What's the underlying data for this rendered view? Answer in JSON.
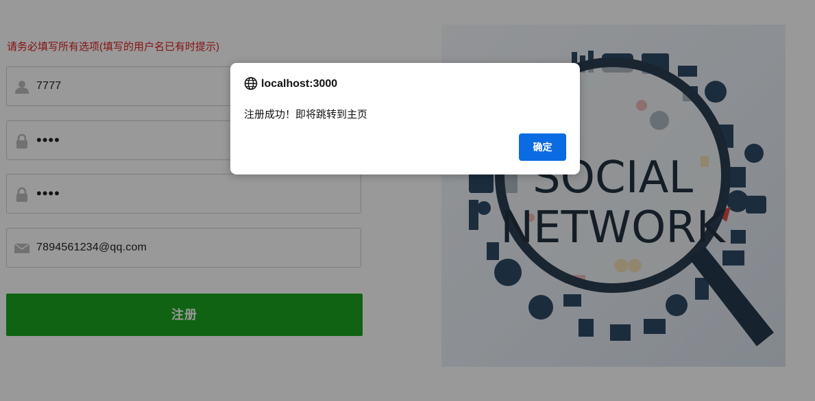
{
  "form": {
    "notice": "请务必填写所有选项(填写的用户名已有时提示)",
    "username_value": "7777",
    "password_value": "••••",
    "confirm_password_value": "••••",
    "email_value": "7894561234@qq.com",
    "register_label": "注册"
  },
  "hero": {
    "text_line1": "SOCIAL",
    "text_line2": "NETWORK",
    "icon": "magnifying-glass-social-network-illustration"
  },
  "dialog": {
    "origin": "localhost:3000",
    "message": "注册成功！即将跳转到主页",
    "ok_label": "确定"
  },
  "colors": {
    "notice": "#e02020",
    "register_button": "#1aa51f",
    "dialog_button": "#0b6be3",
    "overlay": "rgba(0,0,0,0.40)"
  }
}
